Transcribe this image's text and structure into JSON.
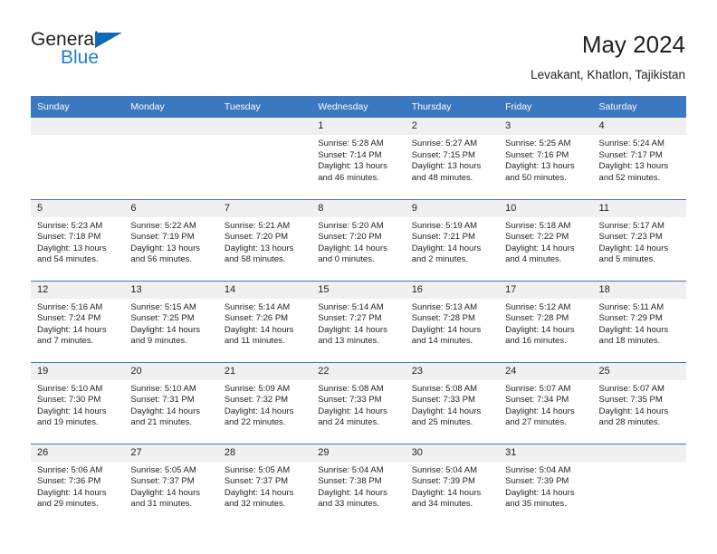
{
  "brand": {
    "name_primary": "General",
    "name_secondary": "Blue",
    "triangle_icon": "blue-triangle-icon",
    "accent_color": "#1c7fd4"
  },
  "header": {
    "title": "May 2024",
    "subtitle": "Levakant, Khatlon, Tajikistan",
    "header_bg_color": "#3b78bf",
    "header_text_color": "#ffffff"
  },
  "calendar": {
    "weekday_headers": [
      "Sunday",
      "Monday",
      "Tuesday",
      "Wednesday",
      "Thursday",
      "Friday",
      "Saturday"
    ],
    "weeks": [
      [
        {
          "day": "",
          "empty": true
        },
        {
          "day": "",
          "empty": true
        },
        {
          "day": "",
          "empty": true
        },
        {
          "day": "1",
          "sunrise": "Sunrise: 5:28 AM",
          "sunset": "Sunset: 7:14 PM",
          "daylight": "Daylight: 13 hours and 46 minutes."
        },
        {
          "day": "2",
          "sunrise": "Sunrise: 5:27 AM",
          "sunset": "Sunset: 7:15 PM",
          "daylight": "Daylight: 13 hours and 48 minutes."
        },
        {
          "day": "3",
          "sunrise": "Sunrise: 5:25 AM",
          "sunset": "Sunset: 7:16 PM",
          "daylight": "Daylight: 13 hours and 50 minutes."
        },
        {
          "day": "4",
          "sunrise": "Sunrise: 5:24 AM",
          "sunset": "Sunset: 7:17 PM",
          "daylight": "Daylight: 13 hours and 52 minutes."
        }
      ],
      [
        {
          "day": "5",
          "sunrise": "Sunrise: 5:23 AM",
          "sunset": "Sunset: 7:18 PM",
          "daylight": "Daylight: 13 hours and 54 minutes."
        },
        {
          "day": "6",
          "sunrise": "Sunrise: 5:22 AM",
          "sunset": "Sunset: 7:19 PM",
          "daylight": "Daylight: 13 hours and 56 minutes."
        },
        {
          "day": "7",
          "sunrise": "Sunrise: 5:21 AM",
          "sunset": "Sunset: 7:20 PM",
          "daylight": "Daylight: 13 hours and 58 minutes."
        },
        {
          "day": "8",
          "sunrise": "Sunrise: 5:20 AM",
          "sunset": "Sunset: 7:20 PM",
          "daylight": "Daylight: 14 hours and 0 minutes."
        },
        {
          "day": "9",
          "sunrise": "Sunrise: 5:19 AM",
          "sunset": "Sunset: 7:21 PM",
          "daylight": "Daylight: 14 hours and 2 minutes."
        },
        {
          "day": "10",
          "sunrise": "Sunrise: 5:18 AM",
          "sunset": "Sunset: 7:22 PM",
          "daylight": "Daylight: 14 hours and 4 minutes."
        },
        {
          "day": "11",
          "sunrise": "Sunrise: 5:17 AM",
          "sunset": "Sunset: 7:23 PM",
          "daylight": "Daylight: 14 hours and 5 minutes."
        }
      ],
      [
        {
          "day": "12",
          "sunrise": "Sunrise: 5:16 AM",
          "sunset": "Sunset: 7:24 PM",
          "daylight": "Daylight: 14 hours and 7 minutes."
        },
        {
          "day": "13",
          "sunrise": "Sunrise: 5:15 AM",
          "sunset": "Sunset: 7:25 PM",
          "daylight": "Daylight: 14 hours and 9 minutes."
        },
        {
          "day": "14",
          "sunrise": "Sunrise: 5:14 AM",
          "sunset": "Sunset: 7:26 PM",
          "daylight": "Daylight: 14 hours and 11 minutes."
        },
        {
          "day": "15",
          "sunrise": "Sunrise: 5:14 AM",
          "sunset": "Sunset: 7:27 PM",
          "daylight": "Daylight: 14 hours and 13 minutes."
        },
        {
          "day": "16",
          "sunrise": "Sunrise: 5:13 AM",
          "sunset": "Sunset: 7:28 PM",
          "daylight": "Daylight: 14 hours and 14 minutes."
        },
        {
          "day": "17",
          "sunrise": "Sunrise: 5:12 AM",
          "sunset": "Sunset: 7:28 PM",
          "daylight": "Daylight: 14 hours and 16 minutes."
        },
        {
          "day": "18",
          "sunrise": "Sunrise: 5:11 AM",
          "sunset": "Sunset: 7:29 PM",
          "daylight": "Daylight: 14 hours and 18 minutes."
        }
      ],
      [
        {
          "day": "19",
          "sunrise": "Sunrise: 5:10 AM",
          "sunset": "Sunset: 7:30 PM",
          "daylight": "Daylight: 14 hours and 19 minutes."
        },
        {
          "day": "20",
          "sunrise": "Sunrise: 5:10 AM",
          "sunset": "Sunset: 7:31 PM",
          "daylight": "Daylight: 14 hours and 21 minutes."
        },
        {
          "day": "21",
          "sunrise": "Sunrise: 5:09 AM",
          "sunset": "Sunset: 7:32 PM",
          "daylight": "Daylight: 14 hours and 22 minutes."
        },
        {
          "day": "22",
          "sunrise": "Sunrise: 5:08 AM",
          "sunset": "Sunset: 7:33 PM",
          "daylight": "Daylight: 14 hours and 24 minutes."
        },
        {
          "day": "23",
          "sunrise": "Sunrise: 5:08 AM",
          "sunset": "Sunset: 7:33 PM",
          "daylight": "Daylight: 14 hours and 25 minutes."
        },
        {
          "day": "24",
          "sunrise": "Sunrise: 5:07 AM",
          "sunset": "Sunset: 7:34 PM",
          "daylight": "Daylight: 14 hours and 27 minutes."
        },
        {
          "day": "25",
          "sunrise": "Sunrise: 5:07 AM",
          "sunset": "Sunset: 7:35 PM",
          "daylight": "Daylight: 14 hours and 28 minutes."
        }
      ],
      [
        {
          "day": "26",
          "sunrise": "Sunrise: 5:06 AM",
          "sunset": "Sunset: 7:36 PM",
          "daylight": "Daylight: 14 hours and 29 minutes."
        },
        {
          "day": "27",
          "sunrise": "Sunrise: 5:05 AM",
          "sunset": "Sunset: 7:37 PM",
          "daylight": "Daylight: 14 hours and 31 minutes."
        },
        {
          "day": "28",
          "sunrise": "Sunrise: 5:05 AM",
          "sunset": "Sunset: 7:37 PM",
          "daylight": "Daylight: 14 hours and 32 minutes."
        },
        {
          "day": "29",
          "sunrise": "Sunrise: 5:04 AM",
          "sunset": "Sunset: 7:38 PM",
          "daylight": "Daylight: 14 hours and 33 minutes."
        },
        {
          "day": "30",
          "sunrise": "Sunrise: 5:04 AM",
          "sunset": "Sunset: 7:39 PM",
          "daylight": "Daylight: 14 hours and 34 minutes."
        },
        {
          "day": "31",
          "sunrise": "Sunrise: 5:04 AM",
          "sunset": "Sunset: 7:39 PM",
          "daylight": "Daylight: 14 hours and 35 minutes."
        },
        {
          "day": "",
          "empty": true
        }
      ]
    ]
  }
}
